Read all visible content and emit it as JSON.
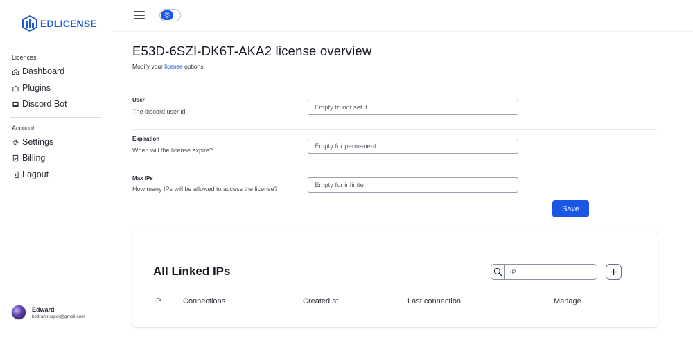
{
  "brand": {
    "name": "EDLICENSE",
    "color": "#1e5bd8"
  },
  "sidebar": {
    "sections": [
      {
        "title": "Licences",
        "items": [
          {
            "label": "Dashboard",
            "icon": "home-icon"
          },
          {
            "label": "Plugins",
            "icon": "puzzle-icon"
          },
          {
            "label": "Discord Bot",
            "icon": "bot-icon"
          }
        ]
      },
      {
        "title": "Account",
        "items": [
          {
            "label": "Settings",
            "icon": "gear-icon"
          },
          {
            "label": "Billing",
            "icon": "receipt-icon"
          },
          {
            "label": "Logout",
            "icon": "logout-icon"
          }
        ]
      }
    ],
    "user": {
      "name": "Edward",
      "email": "beltranmarper@gmail.com"
    }
  },
  "topbar": {
    "menu_icon": "hamburger-icon",
    "theme_toggle_icon": "sun-icon"
  },
  "page": {
    "title": "E53D-6SZI-DK6T-AKA2 license overview",
    "subtitle_prefix": "Modify your ",
    "subtitle_link": "license",
    "subtitle_suffix": " options."
  },
  "form": {
    "fields": [
      {
        "label": "User",
        "description": "The discord user id",
        "placeholder": "Empty to not set it",
        "value": ""
      },
      {
        "label": "Expiration",
        "description": "When will the license expire?",
        "placeholder": "Empty for permanent",
        "value": ""
      },
      {
        "label": "Max IPs",
        "description": "How many IPs will be allowed to access the license?",
        "placeholder": "Empty for infinite",
        "value": ""
      }
    ],
    "save_label": "Save"
  },
  "linked_ips": {
    "title": "All Linked IPs",
    "search_placeholder": "IP",
    "columns": [
      "IP",
      "Connections",
      "Created at",
      "Last connection",
      "Manage"
    ]
  },
  "colors": {
    "accent": "#1a57e6",
    "text": "#1f2430"
  }
}
